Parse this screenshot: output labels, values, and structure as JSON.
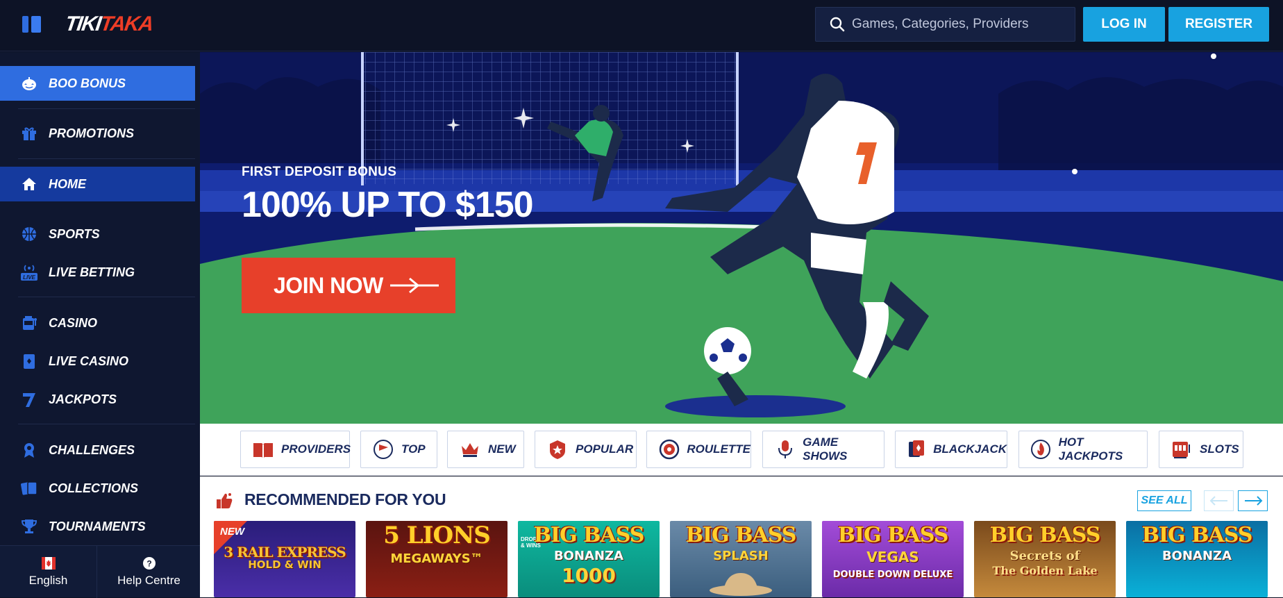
{
  "header": {
    "logo_left": "TIKI",
    "logo_right": "TAKA",
    "search_placeholder": "Games, Categories, Providers",
    "login_label": "LOG IN",
    "register_label": "REGISTER"
  },
  "sidebar": {
    "items": [
      {
        "label": "BOO BONUS",
        "icon": "pumpkin-icon"
      },
      {
        "label": "PROMOTIONS",
        "icon": "gift-icon"
      },
      {
        "label": "HOME",
        "icon": "home-icon"
      },
      {
        "label": "SPORTS",
        "icon": "basketball-icon"
      },
      {
        "label": "LIVE BETTING",
        "icon": "live-broadcast-icon"
      },
      {
        "label": "CASINO",
        "icon": "slot-machine-icon"
      },
      {
        "label": "LIVE CASINO",
        "icon": "card-icon"
      },
      {
        "label": "JACKPOTS",
        "icon": "seven-icon"
      },
      {
        "label": "CHALLENGES",
        "icon": "badge-icon"
      },
      {
        "label": "COLLECTIONS",
        "icon": "collection-icon"
      },
      {
        "label": "TOURNAMENTS",
        "icon": "trophy-icon"
      }
    ],
    "footer": {
      "language": "English",
      "help": "Help Centre"
    }
  },
  "hero": {
    "eyebrow": "FIRST DEPOSIT BONUS",
    "headline": "100% UP TO $150",
    "cta": "JOIN NOW",
    "colors": {
      "field": "#3fa35a",
      "sky": "#0e1c6e",
      "cta": "#e7402a"
    }
  },
  "categories": [
    {
      "label": "PROVIDERS",
      "icon": "book-icon"
    },
    {
      "label": "TOP",
      "icon": "flag-icon"
    },
    {
      "label": "NEW",
      "icon": "crown-icon"
    },
    {
      "label": "POPULAR",
      "icon": "star-badge-icon"
    },
    {
      "label": "ROULETTE",
      "icon": "roulette-icon"
    },
    {
      "label": "GAME SHOWS",
      "icon": "microphone-icon"
    },
    {
      "label": "BLACKJACK",
      "icon": "playing-card-icon"
    },
    {
      "label": "HOT JACKPOTS",
      "icon": "flame-icon"
    },
    {
      "label": "SLOTS",
      "icon": "slots-icon"
    }
  ],
  "recommended": {
    "title": "RECOMMENDED FOR YOU",
    "see_all": "SEE ALL",
    "games": [
      {
        "line1": "3 RAIL EXPRESS",
        "line2": "HOLD & WIN",
        "line3": "",
        "badge": "NEW"
      },
      {
        "line1": "5 LIONS",
        "line2": "MEGAWAYS™",
        "line3": "",
        "badge": ""
      },
      {
        "line1": "BIG BASS",
        "line2": "BONANZA",
        "line3": "1000",
        "badge": "DROPS & WINS"
      },
      {
        "line1": "BIG BASS",
        "line2": "SPLASH",
        "line3": "",
        "badge": ""
      },
      {
        "line1": "BIG BASS",
        "line2": "VEGAS",
        "line3": "DOUBLE DOWN DELUXE",
        "badge": ""
      },
      {
        "line1": "BIG BASS",
        "line2": "Secrets of",
        "line3": "The Golden Lake",
        "badge": ""
      },
      {
        "line1": "BIG BASS",
        "line2": "BONANZA",
        "line3": "",
        "badge": ""
      }
    ]
  }
}
